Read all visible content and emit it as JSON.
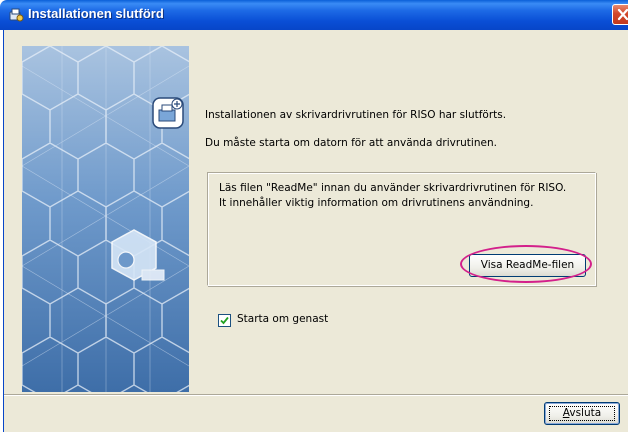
{
  "window": {
    "title": "Installationen slutförd",
    "title_icon": "installer-icon",
    "close_icon": "close-icon"
  },
  "messages": {
    "line1": "Installationen av skrivardrivrutinen för RISO har slutförts.",
    "line2": "Du måste starta om datorn för att använda drivrutinen."
  },
  "readme_group": {
    "line1": "Läs filen \"ReadMe\" innan du använder skrivardrivrutinen för RISO.",
    "line2": "It innehåller viktig information om drivrutinens användning.",
    "button_label": "Visa ReadMe-filen"
  },
  "restart": {
    "label": "Starta om genast",
    "checked": true
  },
  "footer": {
    "finish_mnemonic": "A",
    "finish_rest": "vsluta"
  },
  "colors": {
    "titlebar": "#0a4fd6",
    "dialog_bg": "#ece9d8",
    "highlight_ring": "#d3208b",
    "panel": "#4a7fb8"
  }
}
